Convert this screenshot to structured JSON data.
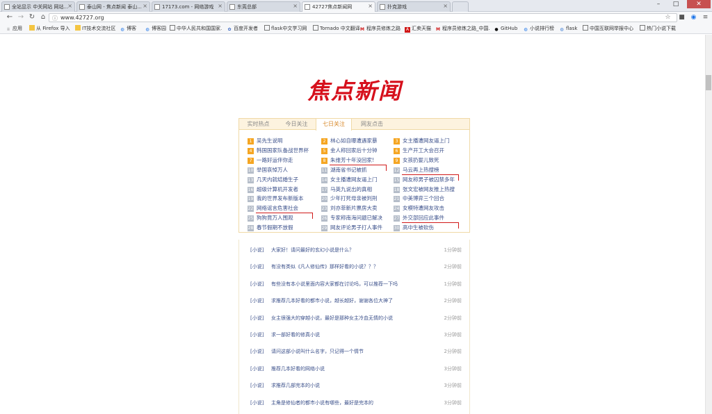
{
  "browser": {
    "tabs": [
      {
        "title": "全站显示 中关网站 网站..."
      },
      {
        "title": "泰山网 - 焦点新闻 泰山..."
      },
      {
        "title": "17173.com - 网络游戏"
      },
      {
        "title": "东莞总部"
      },
      {
        "title": "42727焦点新闻网"
      },
      {
        "title": "扑克游戏"
      }
    ],
    "address": "www.42727.org",
    "bookmarks": [
      "应用",
      "从 Firefox 导入",
      "IT技术交流社区",
      "博客",
      "博客园",
      "中华人民共和国国家...",
      "百度开发者",
      "flask中文学习网",
      "Tornado 中文翻译",
      "程序员修炼之路",
      "汇卖天猫",
      "程序员修炼之路_中国...",
      "GitHub",
      "小说排行榜",
      "flask",
      "中国互联网举报中心",
      "热门小说下载"
    ]
  },
  "logo": {
    "text": "焦点新闻"
  },
  "hot": {
    "tabs": [
      "实时热点",
      "今日关注",
      "七日关注",
      "网友点击"
    ],
    "items": [
      {
        "num": "1",
        "text": "吴先生说明"
      },
      {
        "num": "2",
        "text": "林心如自曝遭遇家暴"
      },
      {
        "num": "3",
        "text": "女主播遭网友逼上门"
      },
      {
        "num": "4",
        "text": "韩国国家队备战世界杯"
      },
      {
        "num": "5",
        "text": "金人称回家后十分钟"
      },
      {
        "num": "6",
        "text": "生产开工大会召开"
      },
      {
        "num": "7",
        "text": "一路好运伴你走"
      },
      {
        "num": "8",
        "text": "朱维芳十年没回家!"
      },
      {
        "num": "9",
        "text": "女孩扔婴儿致死"
      },
      {
        "num": "10",
        "text": "举国哀悼万人"
      },
      {
        "num": "11",
        "text": "湖南省书记被抓"
      },
      {
        "num": "12",
        "text": "马云再上热搜榜"
      },
      {
        "num": "13",
        "text": "几天内就结婚生子"
      },
      {
        "num": "14",
        "text": "女主播遭网友逼上门"
      },
      {
        "num": "15",
        "text": "网友称男子被囚禁多年"
      },
      {
        "num": "16",
        "text": "超级计算机开发者"
      },
      {
        "num": "17",
        "text": "马英九说出的真相"
      },
      {
        "num": "18",
        "text": "张文宏被网友推上热搜"
      },
      {
        "num": "19",
        "text": "我的世界发布新版本"
      },
      {
        "num": "20",
        "text": "少年打死母亲被判刑"
      },
      {
        "num": "21",
        "text": "中美博弈三个回合"
      },
      {
        "num": "22",
        "text": "网络谣言危害社会"
      },
      {
        "num": "23",
        "text": "刘亦菲新片票房大卖"
      },
      {
        "num": "24",
        "text": "女模特遭网友攻击"
      },
      {
        "num": "25",
        "text": "狗狗竟万人围观"
      },
      {
        "num": "26",
        "text": "专家称南海问题已解决"
      },
      {
        "num": "27",
        "text": "外交部回应此事件"
      },
      {
        "num": "28",
        "text": "春节假期不放假"
      },
      {
        "num": "29",
        "text": "网友评论男子打人事件"
      },
      {
        "num": "30",
        "text": "高中生被砍伤"
      }
    ]
  },
  "news": [
    {
      "cat": "[小说]",
      "title": "大家好！请问最好的玄幻小说是什么？",
      "time": "1分钟前"
    },
    {
      "cat": "[小说]",
      "title": "有没有类似《凡人修仙传》那样好看的小说？？？",
      "time": "2分钟前"
    },
    {
      "cat": "[小说]",
      "title": "有些没有本小说里面内容大家都在讨论吗，可以推荐一下吗",
      "time": "1分钟前"
    },
    {
      "cat": "[小说]",
      "title": "求推荐几本好看的都市小说，越长越好，谢谢各位大神了",
      "time": "2分钟前"
    },
    {
      "cat": "[小说]",
      "title": "女主很强大的穿越小说，最好是那种女主冷血无情的小说",
      "time": "2分钟前"
    },
    {
      "cat": "[小说]",
      "title": "求一部好看的修真小说",
      "time": "3分钟前"
    },
    {
      "cat": "[小说]",
      "title": "请问这部小说叫什么名字，只记得一个情节",
      "time": "2分钟前"
    },
    {
      "cat": "[小说]",
      "title": "推荐几本好看的网络小说",
      "time": "3分钟前"
    },
    {
      "cat": "[小说]",
      "title": "求推荐几部完本的小说",
      "time": "3分钟前"
    },
    {
      "cat": "[小说]",
      "title": "主角是修仙者的都市小说有哪些，最好是完本的",
      "time": "3分钟前"
    }
  ]
}
